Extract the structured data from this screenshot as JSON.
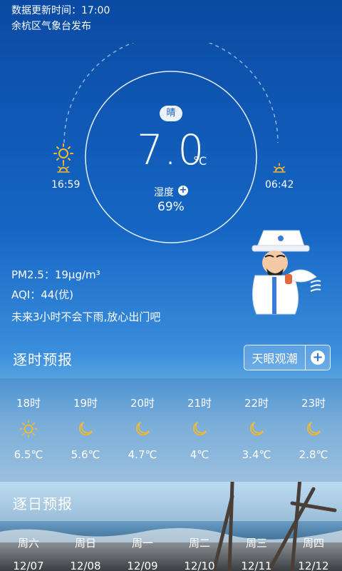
{
  "header": {
    "update_time": "数据更新时间：17:00",
    "publisher": "余杭区气象台发布"
  },
  "current": {
    "condition": "晴",
    "temperature": "7.0",
    "unit": "°C",
    "humidity_label": "湿度",
    "humidity_add": "+",
    "humidity_value": "69%",
    "sunrise": "16:59",
    "sunset": "06:42"
  },
  "air": {
    "pm25": "PM2.5：19μg/m³",
    "aqi": "AQI：44(优)",
    "rain_message": "未来3小时不会下雨,放心出门吧"
  },
  "hourly": {
    "title": "逐时预报",
    "tide_button": "天眼观潮",
    "tide_add": "+",
    "items": [
      {
        "time": "18时",
        "icon": "sun-icon",
        "temp": "6.5℃"
      },
      {
        "time": "19时",
        "icon": "moon-icon",
        "temp": "5.6℃"
      },
      {
        "time": "20时",
        "icon": "moon-icon",
        "temp": "4.7℃"
      },
      {
        "time": "21时",
        "icon": "moon-icon",
        "temp": "4℃"
      },
      {
        "time": "22时",
        "icon": "moon-icon",
        "temp": "3.4℃"
      },
      {
        "time": "23时",
        "icon": "moon-icon",
        "temp": "2.8℃"
      }
    ]
  },
  "daily": {
    "title": "逐日预报",
    "items": [
      {
        "weekday": "周六",
        "date": "12/07"
      },
      {
        "weekday": "周日",
        "date": "12/08"
      },
      {
        "weekday": "周一",
        "date": "12/09"
      },
      {
        "weekday": "周二",
        "date": "12/10"
      },
      {
        "weekday": "周三",
        "date": "12/11"
      },
      {
        "weekday": "周四",
        "date": "12/12"
      }
    ]
  },
  "colors": {
    "icon_yellow": "#f5b82e",
    "badge_text": "#1a5fb8"
  }
}
